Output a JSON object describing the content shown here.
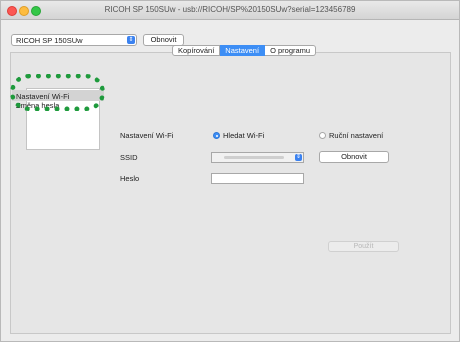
{
  "window": {
    "title": "RICOH SP 150SUw - usb://RICOH/SP%20150SUw?serial=123456789"
  },
  "colors": {
    "accent": "#3d8ef5",
    "highlight_ring": "#1e9a3c",
    "close": "#fc5753",
    "minimize": "#fdbc40",
    "zoom": "#33c748"
  },
  "toolbar": {
    "printer_select_value": "RICOH SP 150SUw",
    "refresh_label": "Obnovit"
  },
  "tabs": [
    {
      "label": "Kopírování",
      "active": false
    },
    {
      "label": "Nastavení",
      "active": true
    },
    {
      "label": "O programu",
      "active": false
    }
  ],
  "sidebar": {
    "items": [
      {
        "label": "Nastavení Wi-Fi",
        "selected": true
      },
      {
        "label": "Změna hesla",
        "selected": false
      }
    ]
  },
  "form": {
    "wifi_label": "Nastavení Wi-Fi",
    "search_option": "Hledat Wi-Fi",
    "manual_option": "Ruční nastavení",
    "selected_option": "Hledat Wi-Fi",
    "ssid_label": "SSID",
    "ssid_value": "",
    "ssid_refresh_label": "Obnovit",
    "password_label": "Heslo",
    "password_value": "",
    "apply_label": "Použít"
  }
}
